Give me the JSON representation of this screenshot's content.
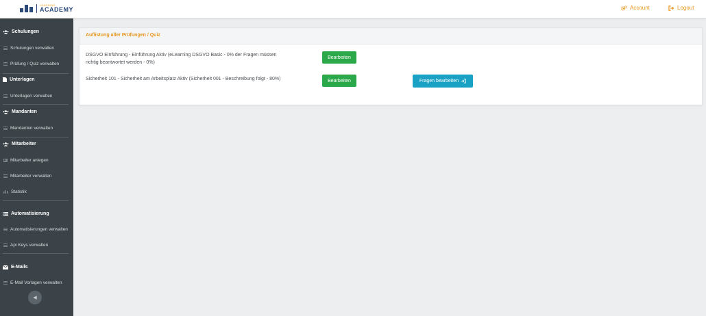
{
  "header": {
    "logo_top": "LEARNING",
    "logo_text": "ACADEMY",
    "account_label": "Account",
    "logout_label": "Logout",
    "accent_color": "#e8961c"
  },
  "sidebar": {
    "sections": [
      {
        "label": "Schulungen",
        "icon": "users-icon",
        "items": [
          "Schulungen verwalten",
          "Prüfung / Quiz verwalten"
        ]
      },
      {
        "label": "Unterlagen",
        "icon": "file-icon",
        "items": [
          "Unterlagen verwalten"
        ]
      },
      {
        "label": "Mandanten",
        "icon": "users-icon",
        "items": [
          "Mandanten verwalten"
        ]
      },
      {
        "label": "Mitarbeiter",
        "icon": "users-icon",
        "items": [
          "Mitarbeiter anlegen",
          "Mitarbeiter verwalten",
          "Statistik"
        ]
      },
      {
        "label": "Automatisierung",
        "icon": "list-icon",
        "items": [
          "Automatisierungen verwalten",
          "Api Keys verwalten"
        ]
      },
      {
        "label": "E-Mails",
        "icon": "envelope-icon",
        "items": [
          "E-Mail Vorlagen verwalten"
        ]
      }
    ],
    "collapse_toggle": "◀"
  },
  "main": {
    "panel_title": "Auflistung aller Prüfungen / Quiz",
    "rows": [
      {
        "text": "DSGVO Einführung - Einführung Aktiv (eLearning DSGVO Basic - 0% der Fragen müssen richtig beantwortet werden - 0%)",
        "edit_label": "Bearbeiten"
      },
      {
        "text": "Sicherheit 101 - Sicherheit am Arbeitsplatz Aktiv (Sicherheit 001 - Beschreibung folgt - 80%)",
        "edit_label": "Bearbeiten",
        "questions_label": "Fragen bearbeiten"
      }
    ],
    "colors": {
      "green": "#2aa84a",
      "teal": "#1aa2c4"
    }
  }
}
